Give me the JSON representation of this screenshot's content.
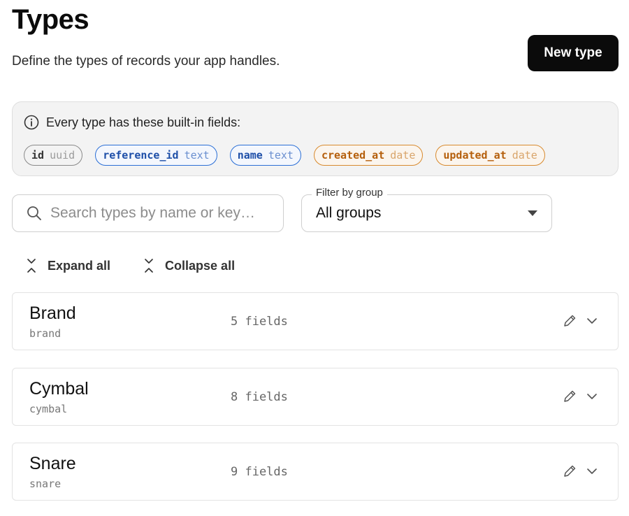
{
  "header": {
    "title": "Types",
    "subtitle": "Define the types of records your app handles.",
    "new_button_label": "New type"
  },
  "builtin": {
    "heading": "Every type has these built-in fields:",
    "fields": [
      {
        "key": "id",
        "type": "uuid",
        "color": "gray"
      },
      {
        "key": "reference_id",
        "type": "text",
        "color": "blue"
      },
      {
        "key": "name",
        "type": "text",
        "color": "blue"
      },
      {
        "key": "created_at",
        "type": "date",
        "color": "orange"
      },
      {
        "key": "updated_at",
        "type": "date",
        "color": "orange"
      }
    ]
  },
  "search": {
    "placeholder": "Search types by name or key…",
    "value": ""
  },
  "filter": {
    "label": "Filter by group",
    "selected": "All groups"
  },
  "toolbar": {
    "expand_label": "Expand all",
    "collapse_label": "Collapse all"
  },
  "types": [
    {
      "name": "Brand",
      "key": "brand",
      "count": "5 fields"
    },
    {
      "name": "Cymbal",
      "key": "cymbal",
      "count": "8 fields"
    },
    {
      "name": "Snare",
      "key": "snare",
      "count": "9 fields"
    }
  ],
  "icons": {
    "info": "info-icon",
    "search": "search-icon",
    "expand": "expand-icon",
    "collapse": "collapse-icon",
    "edit": "pencil-icon",
    "chevron": "chevron-down-icon"
  },
  "colors": {
    "primary": "#0b0b0b",
    "chip_blue": "#2b6fd6",
    "chip_orange": "#d88a2e",
    "chip_gray": "#8a8a8a"
  }
}
